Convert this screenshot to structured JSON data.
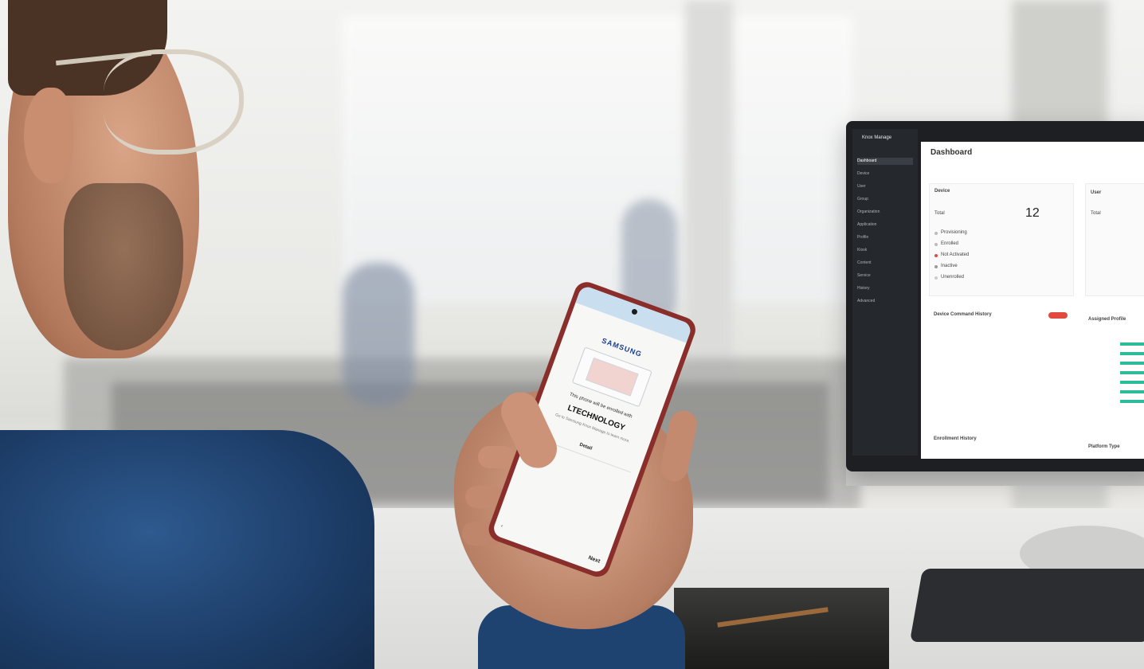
{
  "monitor": {
    "brand": "Knox Manage",
    "title": "Dashboard",
    "nav": [
      "Dashboard",
      "Device",
      "User",
      "Group",
      "Organization",
      "Application",
      "Profile",
      "Kiosk",
      "Content",
      "Service",
      "History",
      "Advanced"
    ],
    "device_section": "Device",
    "total_label": "Total",
    "total_value": "12",
    "device_statuses": [
      "Provisioning",
      "Enrolled",
      "Not Activated",
      "Inactive",
      "Unenrolled"
    ],
    "user_section": "User",
    "user_total_label": "Total",
    "history_title": "Device Command History",
    "assigned_title": "Assigned Profile",
    "enrollment_title": "Enrollment History",
    "platform_title": "Platform Type",
    "colors": {
      "accent": "#2dbb9a",
      "alert": "#e14b3f",
      "sidebar": "#25282c"
    }
  },
  "phone": {
    "brand": "SAMSUNG",
    "message": "This phone will be enrolled with",
    "organization": "LTECHNOLOGY",
    "details": "Go to Samsung Knox Manage to learn more.",
    "details_button": "Detail",
    "next_button": "Next",
    "back_button": "‹"
  }
}
